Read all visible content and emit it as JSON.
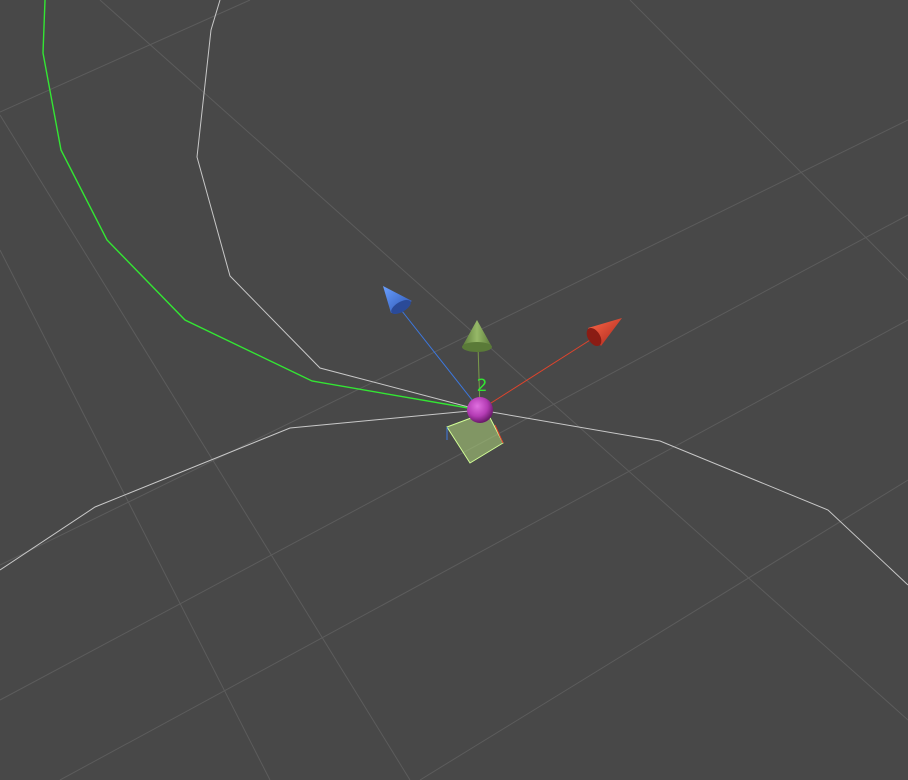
{
  "scene": {
    "background_color": "#484848",
    "grid_color": "#5c5c5c",
    "path_color": "#c8c8c8",
    "selected_path_color": "#33e633"
  },
  "waypoint": {
    "label": "2",
    "label_color": "#33e633",
    "handle_color": "#b43cb4"
  },
  "gizmo": {
    "x_axis_color": "#e0442c",
    "y_axis_color": "#7a9a4a",
    "z_axis_color": "#3c78e0"
  },
  "plane_handle": {
    "fill": "#a8cc78",
    "outline": "#d2ff96"
  }
}
